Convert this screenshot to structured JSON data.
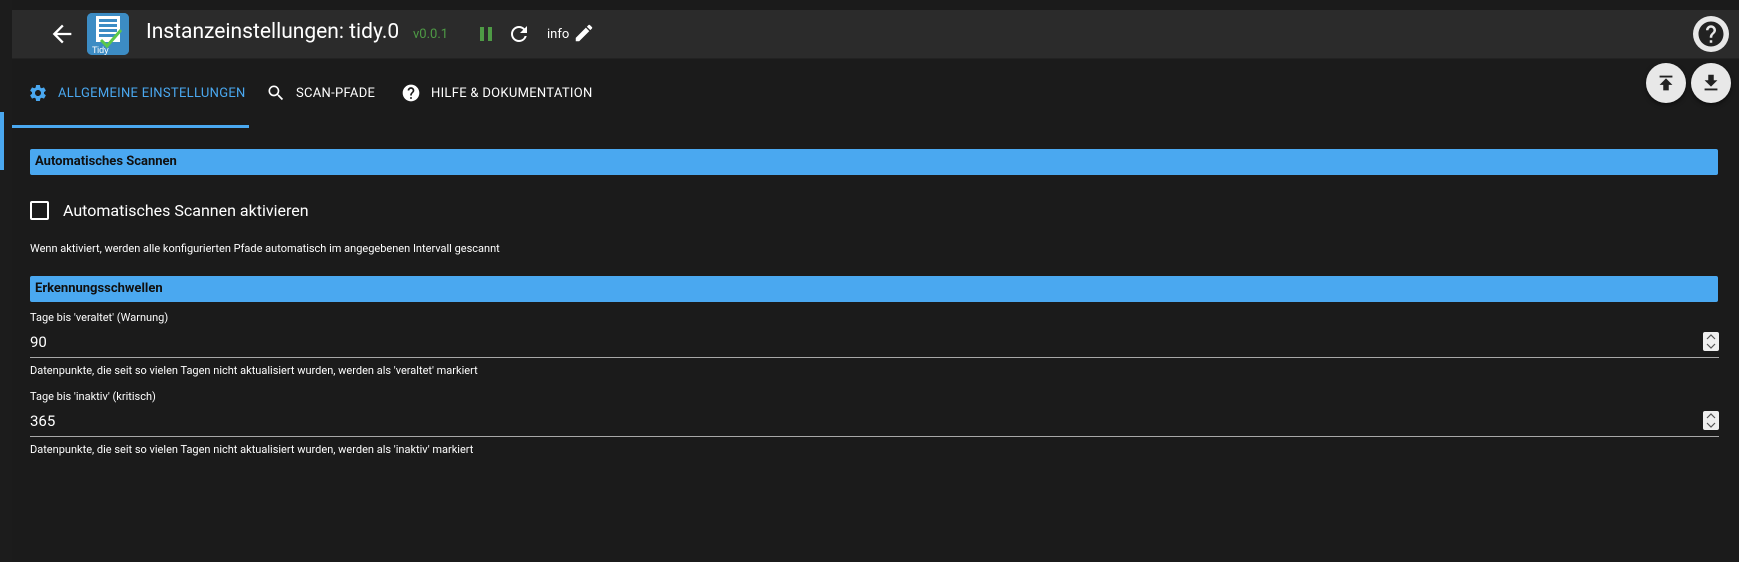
{
  "header": {
    "title": "Instanzeinstellungen: tidy.0",
    "version": "v0.0.1",
    "log_level": "info",
    "logo_text": "Tidy"
  },
  "tabs": [
    {
      "label": "ALLGEMEINE EINSTELLUNGEN",
      "icon": "gear-icon",
      "active": true
    },
    {
      "label": "SCAN-PFADE",
      "icon": "search-icon",
      "active": false
    },
    {
      "label": "HILFE & DOKUMENTATION",
      "icon": "help-circle-icon",
      "active": false
    }
  ],
  "sections": {
    "auto_scan": {
      "title": "Automatisches Scannen",
      "checkbox_label": "Automatisches Scannen aktivieren",
      "checked": false,
      "help": "Wenn aktiviert, werden alle konfigurierten Pfade automatisch im angegebenen Intervall gescannt"
    },
    "thresholds": {
      "title": "Erkennungsschwellen",
      "stale": {
        "label": "Tage bis 'veraltet' (Warnung)",
        "value": "90",
        "help": "Datenpunkte, die seit so vielen Tagen nicht aktualisiert wurden, werden als 'veraltet' markiert"
      },
      "inactive": {
        "label": "Tage bis 'inaktiv' (kritisch)",
        "value": "365",
        "help": "Datenpunkte, die seit so vielen Tagen nicht aktualisiert wurden, werden als 'inaktiv' markiert"
      }
    }
  },
  "colors": {
    "accent": "#4aa8f0",
    "version": "#4e9a45",
    "background": "#1b1b1b",
    "header": "#2b2b2b"
  }
}
